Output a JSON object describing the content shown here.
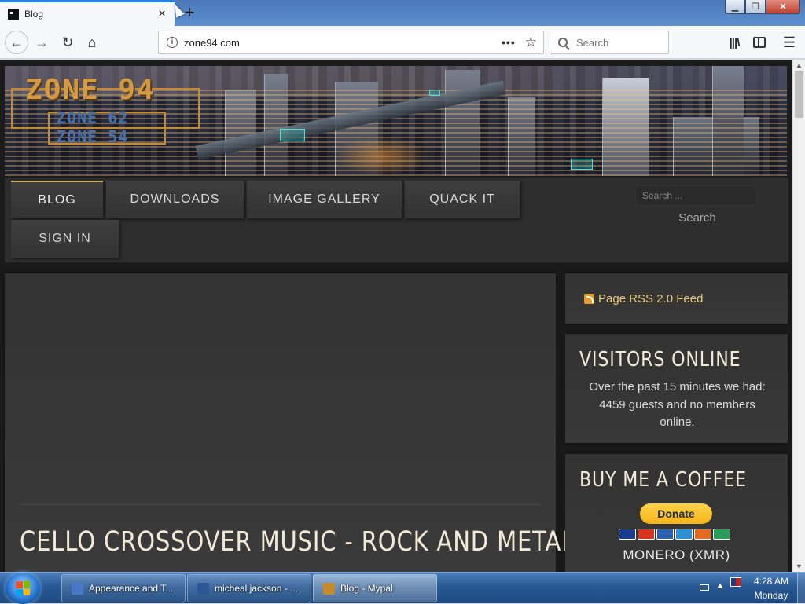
{
  "browser": {
    "tab": {
      "title": "Blog",
      "close_label": "×"
    },
    "new_tab_label": "+",
    "window_controls": {
      "minimize": "▁",
      "maximize": "❐",
      "close": "✕"
    },
    "url": "zone94.com",
    "page_actions_label": "•••",
    "bookmark_label": "☆",
    "search_placeholder": "Search",
    "buttons": {
      "back": "←",
      "forward": "→",
      "reload": "↻",
      "home": "⌂",
      "library": "|||\\",
      "menu": "☰"
    },
    "scroll": {
      "up": "▲",
      "down": "▼"
    }
  },
  "site": {
    "logo": {
      "main": "ZONE 94",
      "sub1": "ZONE 62",
      "sub2": "ZONE 54"
    },
    "nav": {
      "blog": "BLOG",
      "downloads": "DOWNLOADS",
      "gallery": "IMAGE GALLERY",
      "quack": "QUACK IT",
      "signin": "SIGN IN"
    },
    "search": {
      "placeholder": "Search ...",
      "button": "Search"
    },
    "article": {
      "title": "CELLO CROSSOVER MUSIC - ROCK AND METAL"
    },
    "sidebar": {
      "rss": "Page RSS 2.0 Feed",
      "visitors": {
        "heading": "VISITORS ONLINE",
        "text": "Over the past 15 minutes we had: 4459 guests and no members online."
      },
      "coffee": {
        "heading": "BUY ME A COFFEE",
        "donate": "Donate",
        "cards": [
          {
            "name": "visa-icon",
            "color": "#1a3b8f"
          },
          {
            "name": "mastercard-icon",
            "color": "#d8331f"
          },
          {
            "name": "maestro-icon",
            "color": "#2b5fb0"
          },
          {
            "name": "amex-icon",
            "color": "#2f8fd1"
          },
          {
            "name": "discover-icon",
            "color": "#e36a1f"
          },
          {
            "name": "paypal-credit-icon",
            "color": "#2a9b5a"
          }
        ],
        "monero": "MONERO (XMR)"
      }
    }
  },
  "taskbar": {
    "items": [
      {
        "label": "Appearance and T...",
        "icon_color": "#4a78c8",
        "active": false
      },
      {
        "label": "micheal jackson - ...",
        "icon_color": "#2b5797",
        "active": false
      },
      {
        "label": "Blog - Mypal",
        "icon_color": "#c58b2a",
        "active": true
      }
    ],
    "clock": {
      "time": "4:28 AM",
      "day": "Monday"
    },
    "start_logo_colors": [
      "#f25022",
      "#7fba00",
      "#00a4ef",
      "#ffb900"
    ]
  }
}
